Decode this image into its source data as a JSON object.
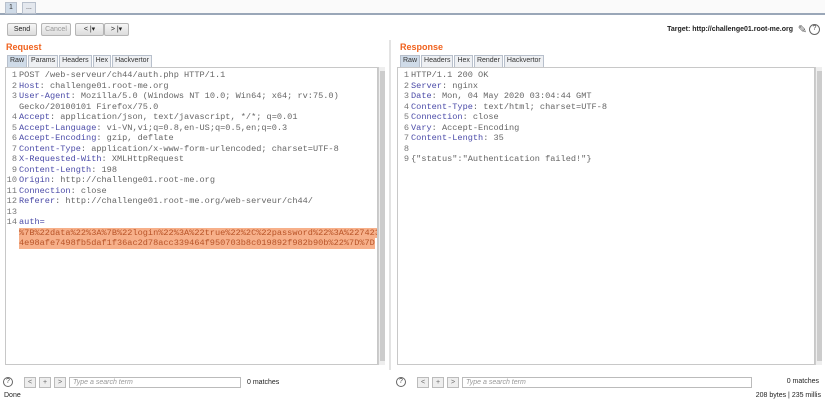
{
  "tabs": [
    "1",
    "..."
  ],
  "toolbar": {
    "send": "Send",
    "cancel": "Cancel",
    "back": "< |▾",
    "forward": "> |▾",
    "target": "Target: http://challenge01.root-me.org"
  },
  "request": {
    "title": "Request",
    "tabs": [
      "Raw",
      "Params",
      "Headers",
      "Hex",
      "Hackvertor"
    ],
    "lines": [
      {
        "n": "1",
        "k": "",
        "v": "POST /web-serveur/ch44/auth.php HTTP/1.1"
      },
      {
        "n": "2",
        "k": "Host",
        "v": ": challenge01.root-me.org"
      },
      {
        "n": "3",
        "k": "User-Agent",
        "v": ": Mozilla/5.0 (Windows NT 10.0; Win64; x64; rv:75.0)"
      },
      {
        "n": "",
        "k": "",
        "v": "Gecko/20100101 Firefox/75.0"
      },
      {
        "n": "4",
        "k": "Accept",
        "v": ": application/json, text/javascript, */*; q=0.01"
      },
      {
        "n": "5",
        "k": "Accept-Language",
        "v": ": vi-VN,vi;q=0.8,en-US;q=0.5,en;q=0.3"
      },
      {
        "n": "6",
        "k": "Accept-Encoding",
        "v": ": gzip, deflate"
      },
      {
        "n": "7",
        "k": "Content-Type",
        "v": ": application/x-www-form-urlencoded; charset=UTF-8"
      },
      {
        "n": "8",
        "k": "X-Requested-With",
        "v": ": XMLHttpRequest"
      },
      {
        "n": "9",
        "k": "Content-Length",
        "v": ": 198"
      },
      {
        "n": "10",
        "k": "Origin",
        "v": ": http://challenge01.root-me.org"
      },
      {
        "n": "11",
        "k": "Connection",
        "v": ": close"
      },
      {
        "n": "12",
        "k": "Referer",
        "v": ": http://challenge01.root-me.org/web-serveur/ch44/"
      },
      {
        "n": "13",
        "k": "",
        "v": ""
      },
      {
        "n": "14",
        "k": "auth=",
        "v": ""
      }
    ],
    "body": [
      "%7B%22data%22%3A%7B%22login%22%3A%22true%22%2C%22password%22%3A%227423",
      "4e98afe7498fb5daf1f36ac2d78acc339464f950703b8c019892f982b90b%22%7D%7D"
    ],
    "search_placeholder": "Type a search term",
    "matches": "0 matches"
  },
  "response": {
    "title": "Response",
    "tabs": [
      "Raw",
      "Headers",
      "Hex",
      "Render",
      "Hackvertor"
    ],
    "lines": [
      {
        "n": "1",
        "k": "",
        "v": "HTTP/1.1 200 OK"
      },
      {
        "n": "2",
        "k": "Server",
        "v": ": nginx"
      },
      {
        "n": "3",
        "k": "Date",
        "v": ": Mon, 04 May 2020 03:04:44 GMT"
      },
      {
        "n": "4",
        "k": "Content-Type",
        "v": ": text/html; charset=UTF-8"
      },
      {
        "n": "5",
        "k": "Connection",
        "v": ": close"
      },
      {
        "n": "6",
        "k": "Vary",
        "v": ": Accept-Encoding"
      },
      {
        "n": "7",
        "k": "Content-Length",
        "v": ": 35"
      },
      {
        "n": "8",
        "k": "",
        "v": ""
      },
      {
        "n": "9",
        "k": "",
        "v": "{\"status\":\"Authentication failed!\"}"
      }
    ],
    "search_placeholder": "Type a search term",
    "matches": "0 matches"
  },
  "status": {
    "left": "Done",
    "right": "208 bytes | 235 millis"
  }
}
